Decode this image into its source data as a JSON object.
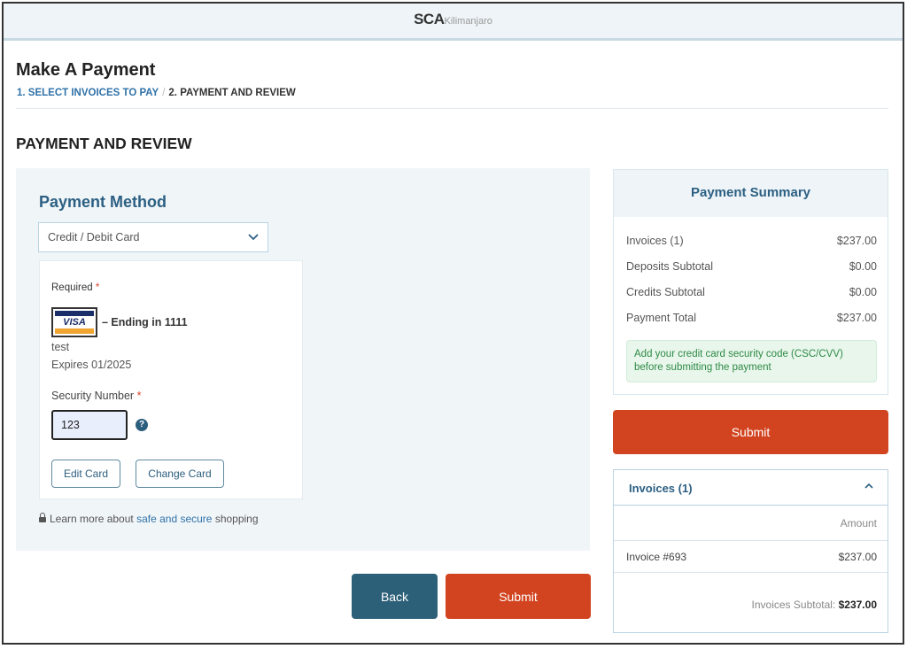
{
  "header": {
    "brand_main": "SCA",
    "brand_sub": "Kilimanjaro"
  },
  "page": {
    "title": "Make A Payment",
    "breadcrumb": [
      {
        "label": "1. SELECT INVOICES TO PAY",
        "active": false
      },
      {
        "label": "2. PAYMENT AND REVIEW",
        "active": true
      }
    ],
    "breadcrumb_sep": "/",
    "section_title": "PAYMENT AND REVIEW"
  },
  "payment_method": {
    "title": "Payment Method",
    "selected_method": "Credit / Debit Card",
    "required_label": "Required",
    "required_mark": "*",
    "card": {
      "brand": "VISA",
      "ending_text": "– Ending in 1111",
      "holder": "test",
      "expires": "Expires 01/2025"
    },
    "security_label": "Security Number",
    "security_value": "123",
    "help_glyph": "?",
    "edit_card_label": "Edit Card",
    "change_card_label": "Change Card",
    "secure_prefix": "Learn more about",
    "secure_link": "safe and secure",
    "secure_suffix": "shopping"
  },
  "actions": {
    "back_label": "Back",
    "submit_label": "Submit"
  },
  "summary": {
    "title": "Payment Summary",
    "rows": [
      {
        "label": "Invoices (1)",
        "value": "$237.00"
      },
      {
        "label": "Deposits Subtotal",
        "value": "$0.00"
      },
      {
        "label": "Credits Subtotal",
        "value": "$0.00"
      },
      {
        "label": "Payment Total",
        "value": "$237.00"
      }
    ],
    "notice": "Add your credit card security code (CSC/CVV) before submitting the payment",
    "submit_label": "Submit"
  },
  "invoices": {
    "title": "Invoices (1)",
    "column_header": "Amount",
    "rows": [
      {
        "name": "Invoice #693",
        "amount": "$237.00"
      }
    ],
    "subtotal_label": "Invoices Subtotal:",
    "subtotal_value": "$237.00"
  },
  "colors": {
    "primary": "#2c6083",
    "submit": "#d24420",
    "back": "#2c6078",
    "notice_bg": "#e8f6ec",
    "notice_text": "#2f8a45"
  }
}
